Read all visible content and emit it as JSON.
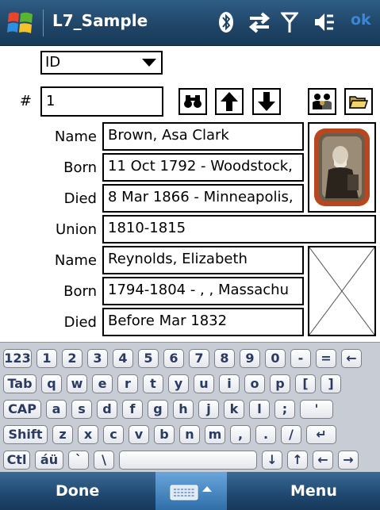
{
  "titlebar": {
    "title": "L7_Sample",
    "ok_label": "ok"
  },
  "form": {
    "search_field": "ID",
    "number_label": "#",
    "number_value": "1",
    "person1": {
      "name_label": "Name",
      "name": "Brown, Asa Clark",
      "born_label": "Born",
      "born": "11 Oct 1792 - Woodstock,",
      "died_label": "Died",
      "died": "8 Mar 1866 - Minneapolis,"
    },
    "union_label": "Union",
    "union": "1810-1815",
    "person2": {
      "name_label": "Name",
      "name": "Reynolds, Elizabeth",
      "born_label": "Born",
      "born": "1794-1804 - , , Massachu",
      "died_label": "Died",
      "died": "Before Mar 1832"
    }
  },
  "keyboard": {
    "row1": [
      "123",
      "1",
      "2",
      "3",
      "4",
      "5",
      "6",
      "7",
      "8",
      "9",
      "0",
      "-",
      "=",
      "←"
    ],
    "row2": [
      "Tab",
      "q",
      "w",
      "e",
      "r",
      "t",
      "y",
      "u",
      "i",
      "o",
      "p",
      "[",
      "]"
    ],
    "row3": [
      "CAP",
      "a",
      "s",
      "d",
      "f",
      "g",
      "h",
      "j",
      "k",
      "l",
      ";",
      "'"
    ],
    "row4": [
      "Shift",
      "z",
      "x",
      "c",
      "v",
      "b",
      "n",
      "m",
      ",",
      ".",
      "/",
      "↵"
    ],
    "row5": [
      "Ctl",
      "áü",
      "`",
      "\\",
      "",
      "↓",
      "↑",
      "←",
      "→"
    ]
  },
  "softkeys": {
    "left": "Done",
    "right": "Menu"
  }
}
